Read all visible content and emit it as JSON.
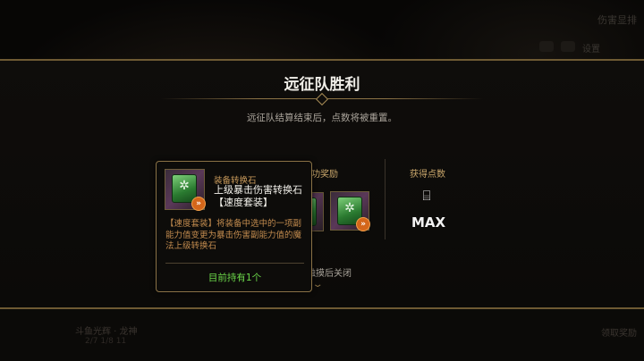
{
  "background": {
    "top_right_text": "伤害显排",
    "icon_text": "设置",
    "bottom_left_line1": "斗鱼光辉 · 龙神",
    "bottom_left_line2": "2/7 1/8 11",
    "bottom_right_text": "领取奖励"
  },
  "dialog": {
    "title": "远征队胜利",
    "subtitle": "远征队结算结束后，点数将被重置。",
    "reward_header": "成功奖励",
    "points_header": "获得点数",
    "points_value": "MAX",
    "close_hint": "触摸后关闭",
    "colors": {
      "accent": "#8a7246",
      "title": "#f1efe9",
      "header": "#c9a76b"
    }
  },
  "tooltip": {
    "category": "装备转换石",
    "name": "上级暴击伤害转换石【速度套装】",
    "description": "【速度套装】将装备中选中的一项副能力值变更为暴击伤害副能力值的魔法上级转换石",
    "owned": "目前持有1个",
    "colors": {
      "owned": "#6cd84a",
      "description": "#c28b4e"
    }
  },
  "icons": {
    "item": "green-spellbook-icon",
    "badge": "orange-upgrade-badge-icon",
    "points": "treasure-chest-icon",
    "close": "chevron-down-icon"
  }
}
